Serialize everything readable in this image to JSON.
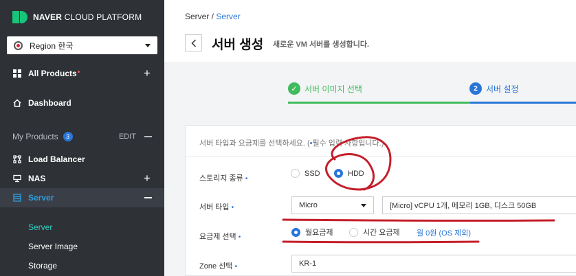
{
  "brand": {
    "bold": "NAVER",
    "light": "CLOUD PLATFORM",
    "accent": "#18c37a"
  },
  "region": {
    "label": "Region 한국"
  },
  "nav": {
    "all_products": "All Products",
    "dashboard": "Dashboard",
    "my_products": "My Products",
    "my_products_count": "3",
    "edit": "EDIT",
    "load_balancer": "Load Balancer",
    "nas": "NAS",
    "server": "Server",
    "sub_items": [
      "Server",
      "Server Image",
      "Storage"
    ]
  },
  "header": {
    "breadcrumb_root": "Server /",
    "breadcrumb_current": "Server",
    "back": "<",
    "title": "서버 생성",
    "subtitle": "새로운 VM 서버를 생성합니다."
  },
  "steps": [
    {
      "label": "서버 이미지 선택",
      "state": "done"
    },
    {
      "number": "2",
      "label": "서버 설정",
      "state": "active"
    }
  ],
  "form": {
    "instruction_pre": "서버 타입과 요금제를 선택하세요. (",
    "instruction_req": "•",
    "instruction_post": "필수 입력 사항입니다.)",
    "storage": {
      "label": "스토리지 종류",
      "options": [
        "SSD",
        "HDD"
      ],
      "selected": "HDD"
    },
    "server_type": {
      "label": "서버 타입",
      "value": "Micro",
      "detail": "[Micro] vCPU 1개, 메모리 1GB, 디스크 50GB"
    },
    "plan": {
      "label": "요금제 선택",
      "options": [
        "월요금제",
        "시간 요금제"
      ],
      "selected": "월요금제",
      "price": "월 0원 (OS 제외)"
    },
    "zone": {
      "label": "Zone 선택",
      "value": "KR-1"
    }
  },
  "colors": {
    "sidebar": "#2e3136",
    "primary": "#2a76d8",
    "success": "#40bb5d",
    "annotation": "#c41e2a"
  }
}
